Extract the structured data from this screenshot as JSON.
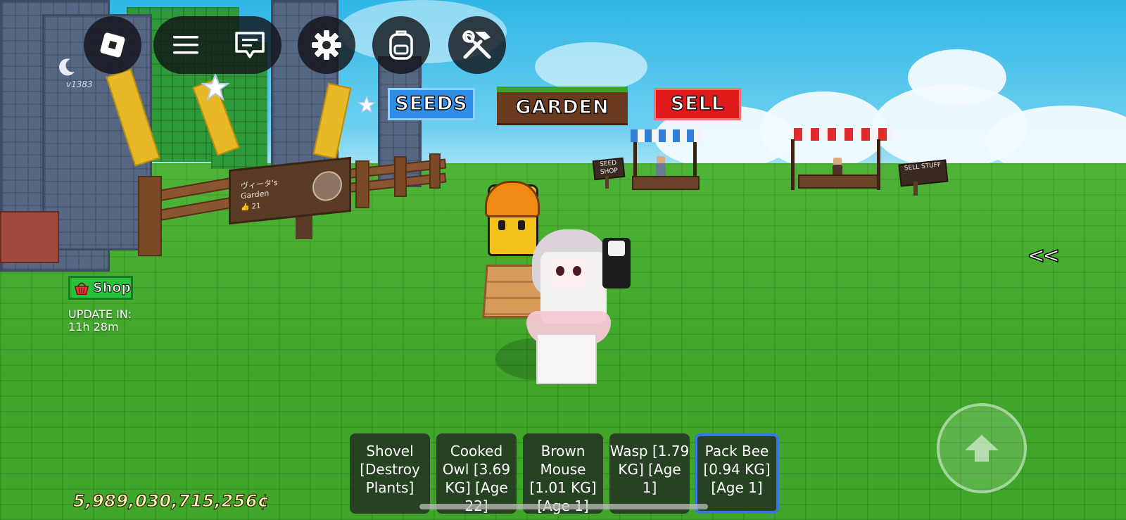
{
  "top_bar": {
    "menu_button": "menu-icon",
    "chat_button": "chat-icon",
    "settings_button": "gear-icon",
    "backpack_button": "backpack-icon",
    "tools_button": "hammer-wrench-icon"
  },
  "version": "v1383",
  "world_signs": {
    "seeds": "SEEDS",
    "garden": "GARDEN",
    "sell": "SELL",
    "seed_shop": "SEED SHOP",
    "sell_stuff": "SELL STUFF"
  },
  "garden_sign": {
    "name": "ヴィータ's Garden",
    "likes": "👍 21"
  },
  "shop": {
    "label": "Shop",
    "update_title": "UPDATE IN:",
    "update_time": "11h 28m"
  },
  "collapse_label": "<<",
  "hotbar": [
    {
      "text": "Shovel [Destroy Plants]",
      "selected": false
    },
    {
      "text": "Cooked Owl [3.69 KG] [Age 22]",
      "selected": false
    },
    {
      "text": "Brown Mouse [1.01 KG] [Age 1]",
      "selected": false
    },
    {
      "text": "Wasp [1.79 KG] [Age 1]",
      "selected": false
    },
    {
      "text": "Pack Bee [0.94 KG] [Age 1]",
      "selected": true
    }
  ],
  "currency": "5,989,030,715,256¢",
  "colors": {
    "sky": "#2fb6e6",
    "grass": "#3fa62a",
    "seeds_sign": "#2f8fe6",
    "sell_sign": "#e01b1b",
    "selected_slot": "#3a74e6",
    "shop_button": "#27c23a"
  }
}
